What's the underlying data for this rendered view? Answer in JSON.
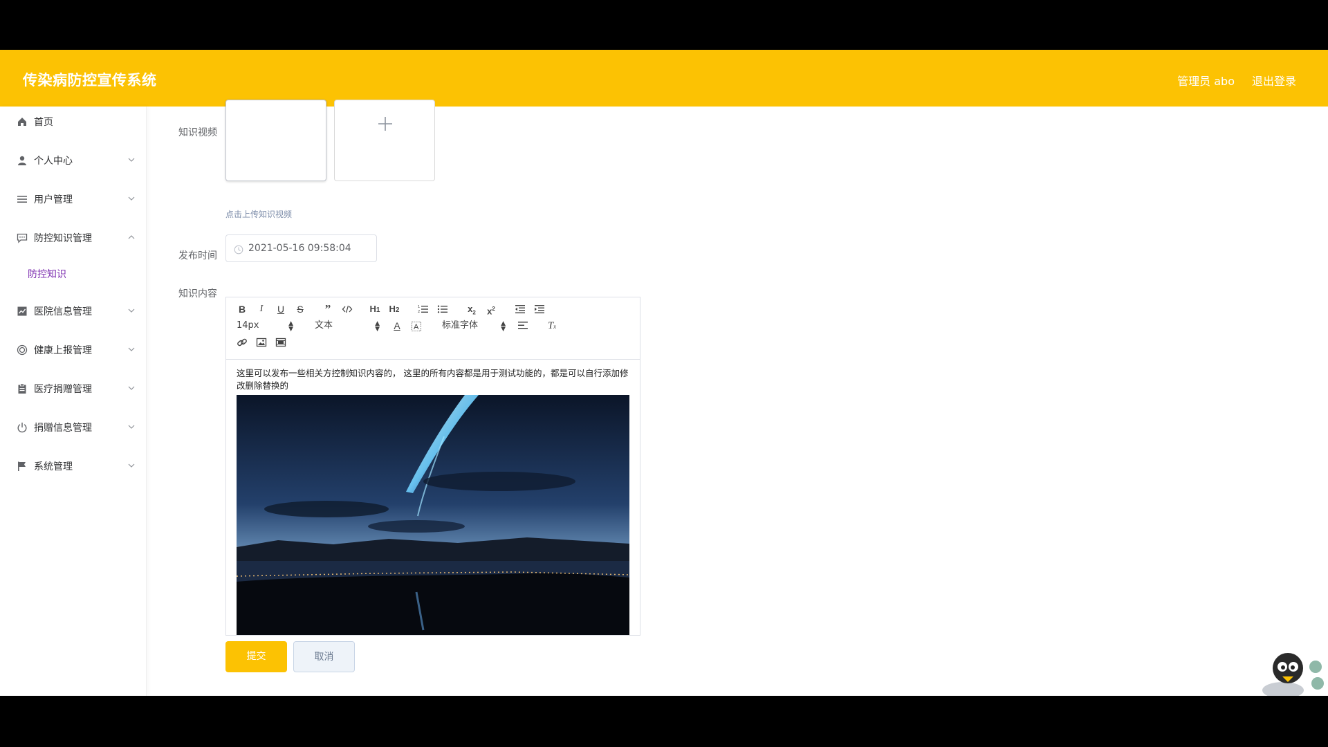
{
  "header": {
    "app_title": "传染病防控宣传系统",
    "admin_label": "管理员 abo",
    "logout_label": "退出登录",
    "brand_color": "#fcc203"
  },
  "sidebar": {
    "items": [
      {
        "label": "首页",
        "icon": "home-icon"
      },
      {
        "label": "个人中心",
        "icon": "user-icon",
        "expanded": false
      },
      {
        "label": "用户管理",
        "icon": "list-icon",
        "expanded": false
      },
      {
        "label": "防控知识管理",
        "icon": "chat-icon",
        "expanded": true
      },
      {
        "label": "医院信息管理",
        "icon": "chart-icon",
        "expanded": false
      },
      {
        "label": "健康上报管理",
        "icon": "circle-icon",
        "expanded": false
      },
      {
        "label": "医疗捐赠管理",
        "icon": "clipboard-icon",
        "expanded": false
      },
      {
        "label": "捐赠信息管理",
        "icon": "power-icon",
        "expanded": false
      },
      {
        "label": "系统管理",
        "icon": "flag-icon",
        "expanded": false
      }
    ],
    "subitems": [
      {
        "label": "防控知识",
        "active": true
      }
    ]
  },
  "form": {
    "video_label": "知识视频",
    "upload_hint": "点击上传知识视频",
    "publish_time_label": "发布时间",
    "publish_time_value": "2021-05-16 09:58:04",
    "content_label": "知识内容"
  },
  "editor": {
    "font_size": "14px",
    "paragraph_type": "文本",
    "font_family": "标准字体",
    "content_text": "这里可以发布一些相关方控制知识内容的， 这里的所有内容都是用于测试功能的，都是可以自行添加修改删除替换的",
    "toolbar_icons": [
      "bold-icon",
      "italic-icon",
      "underline-icon",
      "strike-icon",
      "quote-icon",
      "code-icon",
      "h1-icon",
      "h2-icon",
      "ordered-list-icon",
      "bullet-list-icon",
      "subscript-icon",
      "superscript-icon",
      "outdent-icon",
      "indent-icon",
      "text-color-icon",
      "background-color-icon",
      "align-icon",
      "clear-format-icon",
      "link-icon",
      "image-icon",
      "video-icon"
    ]
  },
  "actions": {
    "submit_label": "提交",
    "cancel_label": "取消"
  }
}
